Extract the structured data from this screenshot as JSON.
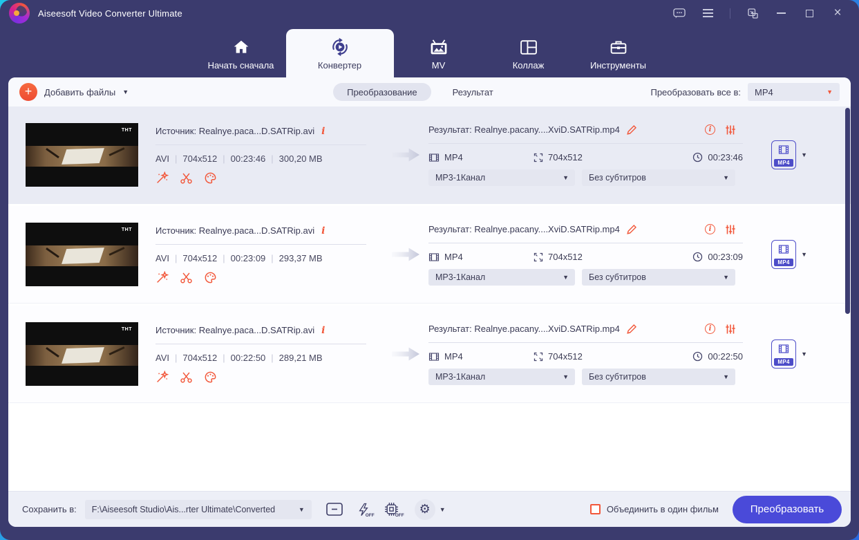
{
  "window": {
    "title": "Aiseesoft Video Converter Ultimate"
  },
  "nav": {
    "tabs": [
      {
        "label": "Начать сначала"
      },
      {
        "label": "Конвертер"
      },
      {
        "label": "MV"
      },
      {
        "label": "Коллаж"
      },
      {
        "label": "Инструменты"
      }
    ]
  },
  "toolbar": {
    "add_files_label": "Добавить файлы",
    "view_convert": "Преобразование",
    "view_result": "Результат",
    "convert_all_label": "Преобразовать все в:",
    "convert_all_value": "MP4"
  },
  "files": [
    {
      "selected": true,
      "thumb_badge": "ТНТ",
      "source_label": "Источник: Realnye.paca...D.SATRip.avi",
      "format": "AVI",
      "resolution": "704x512",
      "duration": "00:23:46",
      "size": "300,20 MB",
      "result_label": "Результат: Realnye.pacany....XviD.SATRip.mp4",
      "out_format": "MP4",
      "out_resolution": "704x512",
      "out_duration": "00:23:46",
      "audio": "MP3-1Канал",
      "subtitles": "Без субтитров",
      "profile_badge": "MP4"
    },
    {
      "selected": false,
      "thumb_badge": "ТНТ",
      "source_label": "Источник: Realnye.paca...D.SATRip.avi",
      "format": "AVI",
      "resolution": "704x512",
      "duration": "00:23:09",
      "size": "293,37 MB",
      "result_label": "Результат: Realnye.pacany....XviD.SATRip.mp4",
      "out_format": "MP4",
      "out_resolution": "704x512",
      "out_duration": "00:23:09",
      "audio": "MP3-1Канал",
      "subtitles": "Без субтитров",
      "profile_badge": "MP4"
    },
    {
      "selected": false,
      "thumb_badge": "ТНТ",
      "source_label": "Источник: Realnye.paca...D.SATRip.avi",
      "format": "AVI",
      "resolution": "704x512",
      "duration": "00:22:50",
      "size": "289,21 MB",
      "result_label": "Результат: Realnye.pacany....XviD.SATRip.mp4",
      "out_format": "MP4",
      "out_resolution": "704x512",
      "out_duration": "00:22:50",
      "audio": "MP3-1Канал",
      "subtitles": "Без субтитров",
      "profile_badge": "MP4"
    }
  ],
  "footer": {
    "save_to_label": "Сохранить в:",
    "save_path": "F:\\Aiseesoft Studio\\Ais...rter Ultimate\\Converted",
    "off_label": "OFF",
    "merge_label": "Объединить в один фильм",
    "convert_button": "Преобразовать"
  },
  "icons": {
    "caret_down": "▼",
    "plus": "+",
    "gear": "⚙",
    "close": "×",
    "info_i": "i"
  },
  "colors": {
    "frame": "#3B3B6E",
    "accent_orange": "#F2573A",
    "primary_button": "#4A4AD9",
    "format_badge": "#4D4DC8",
    "selected_row": "#E9EBF4"
  }
}
